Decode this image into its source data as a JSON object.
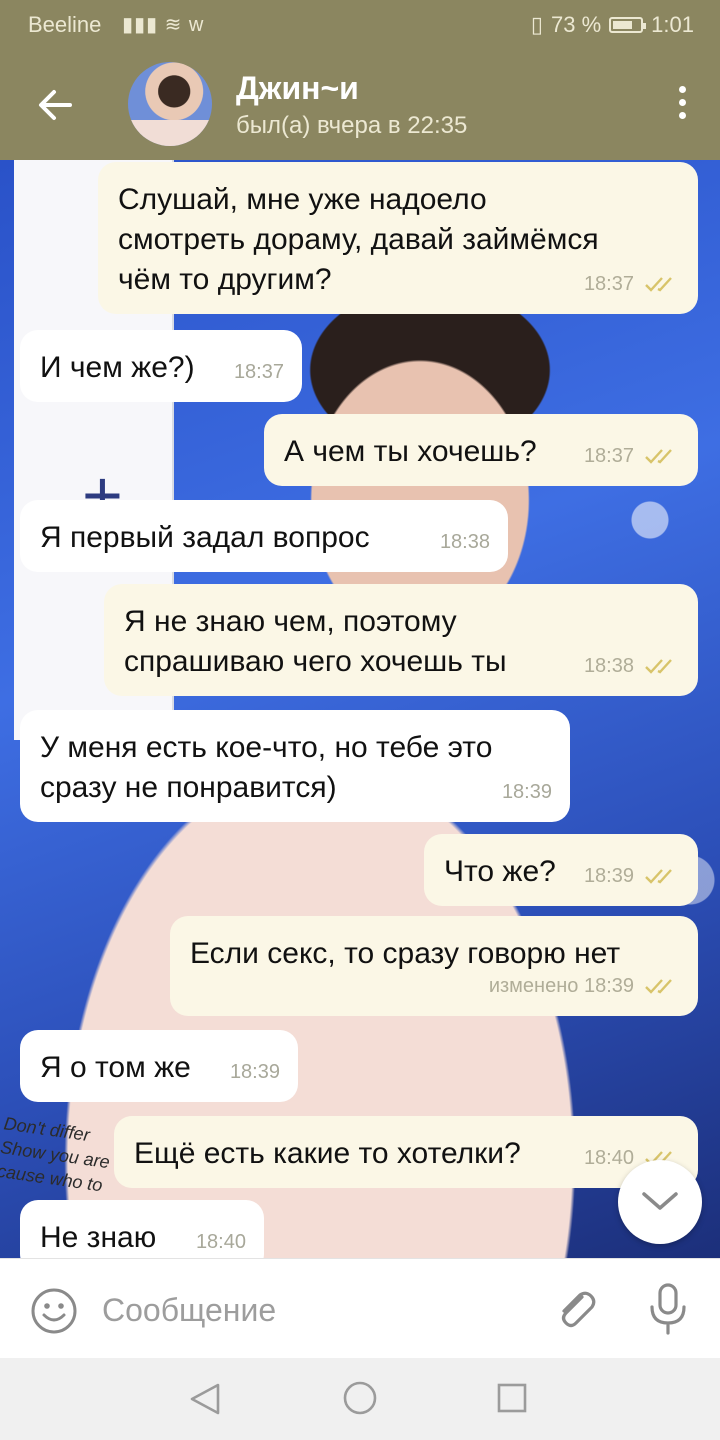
{
  "status_bar": {
    "carrier": "Beeline",
    "signal_extra": "᯾ ᯤ",
    "battery_text": "73 %",
    "battery_level": 0.73,
    "time": "1:01"
  },
  "header": {
    "title": "Джин~и",
    "subtitle": "был(а) вчера в 22:35"
  },
  "messages": [
    {
      "dir": "out",
      "text": "Слушай, мне уже надоело\nсмотреть дораму, давай займёмся\nчём то другим?",
      "time": "18:37"
    },
    {
      "dir": "in",
      "text": "И чем же?)",
      "time": "18:37"
    },
    {
      "dir": "out",
      "text": "А чем ты хочешь?",
      "time": "18:37"
    },
    {
      "dir": "in",
      "text": "Я первый задал вопрос",
      "time": "18:38"
    },
    {
      "dir": "out",
      "text": "Я не знаю чем, поэтому\nспрашиваю чего хочешь ты",
      "time": "18:38"
    },
    {
      "dir": "in",
      "text": "У меня есть кое-что, но тебе это\nсразу не понравится)",
      "time": "18:39"
    },
    {
      "dir": "out",
      "text": "Что же?",
      "time": "18:39"
    },
    {
      "dir": "out",
      "text": "Если секс, то сразу говорю нет",
      "time": "изменено 18:39"
    },
    {
      "dir": "in",
      "text": "Я о том же",
      "time": "18:39"
    },
    {
      "dir": "out",
      "text": "Ещё есть какие то хотелки?",
      "time": "18:40"
    },
    {
      "dir": "in",
      "text": "Не знаю",
      "time": "18:40"
    }
  ],
  "input": {
    "placeholder": "Сообщение"
  },
  "wall_text": "Don't differ\nShow you are\ncause who to",
  "colors": {
    "header_bg": "#8b8660",
    "outgoing_bubble": "#fbf7e6",
    "incoming_bubble": "#ffffff",
    "read_check": "#d8c46a"
  },
  "icons": [
    "back-arrow-icon",
    "menu-dots-icon",
    "double-check-icon",
    "chevron-down-icon",
    "emoji-icon",
    "attach-icon",
    "mic-icon",
    "nav-back-icon",
    "nav-home-icon",
    "nav-recent-icon"
  ]
}
